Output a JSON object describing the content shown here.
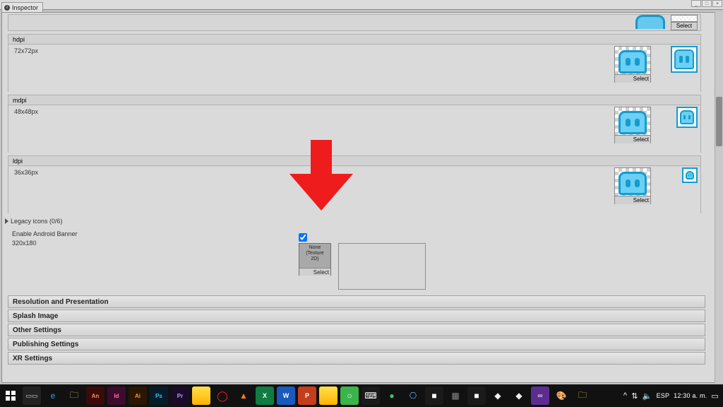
{
  "tab": {
    "title": "Inspector"
  },
  "window_controls": {
    "min": "_",
    "max": "□",
    "close": "×"
  },
  "toprow": {
    "select_label": "Select"
  },
  "dpi_rows": {
    "hdpi": {
      "header": "hdpi",
      "size": "72x72px",
      "select_label": "Select"
    },
    "mdpi": {
      "header": "mdpi",
      "size": "48x48px",
      "select_label": "Select"
    },
    "ldpi": {
      "header": "ldpi",
      "size": "36x36px",
      "select_label": "Select"
    }
  },
  "legacy": {
    "fold_label": "Legacy icons (0/6)",
    "enable_banner_label": "Enable Android Banner",
    "banner_size": "320x180",
    "enable_banner_checked": true,
    "texture_placeholder": "None\n(Texture\n2D)",
    "select_label": "Select"
  },
  "bars": {
    "b1": "Resolution and Presentation",
    "b2": "Splash Image",
    "b3": "Other Settings",
    "b4": "Publishing Settings",
    "b5": "XR Settings"
  },
  "taskbar": {
    "systray": {
      "chevron": "^",
      "wifi": "⇅",
      "vol": "🔈",
      "lang": "ESP",
      "time": "12:30 a. m."
    }
  }
}
